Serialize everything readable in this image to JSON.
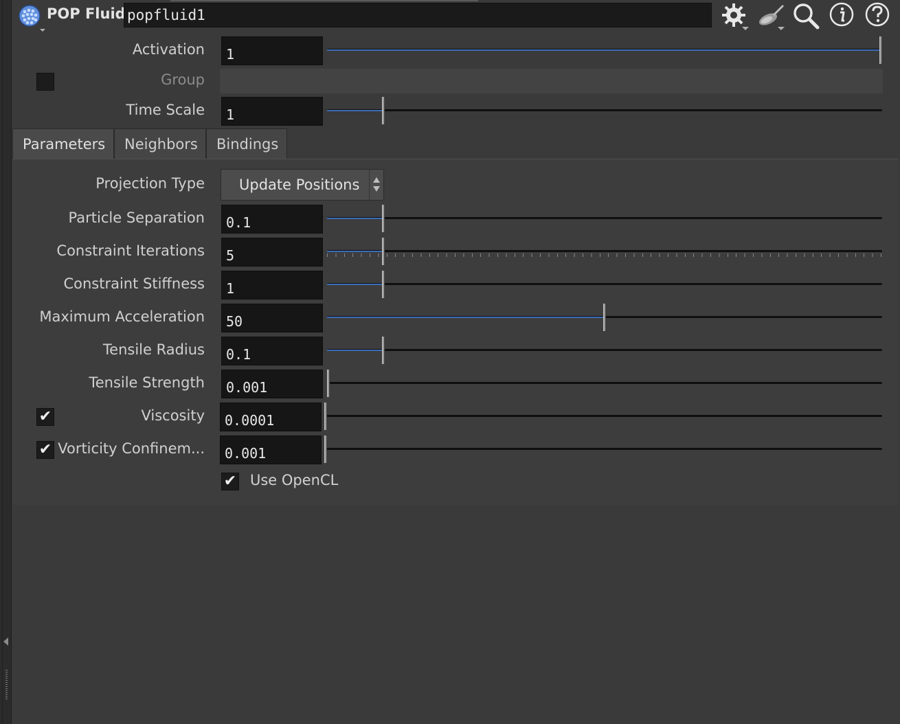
{
  "header": {
    "node_type": "POP Fluid",
    "node_name": "popfluid1",
    "icons": [
      "node-type-icon",
      "gear-icon",
      "paint-brush-icon",
      "search-icon",
      "info-icon",
      "help-icon"
    ]
  },
  "top_params": {
    "activation": {
      "label": "Activation",
      "value": "1",
      "slider_fraction": 1.0
    },
    "group": {
      "label": "Group",
      "checked": false
    },
    "time_scale": {
      "label": "Time Scale",
      "value": "1",
      "slider_fraction": 0.1
    }
  },
  "tabs": [
    {
      "label": "Parameters",
      "active": true
    },
    {
      "label": "Neighbors",
      "active": false
    },
    {
      "label": "Bindings",
      "active": false
    }
  ],
  "parameters": {
    "projection_type": {
      "label": "Projection Type",
      "value": "Update Positions"
    },
    "particle_separation": {
      "label": "Particle Separation",
      "value": "0.1",
      "slider_fraction": 0.1
    },
    "constraint_iterations": {
      "label": "Constraint Iterations",
      "value": "5",
      "slider_fraction": 0.1
    },
    "constraint_stiffness": {
      "label": "Constraint Stiffness",
      "value": "1",
      "slider_fraction": 0.1
    },
    "maximum_acceleration": {
      "label": "Maximum Acceleration",
      "value": "50",
      "slider_fraction": 0.5
    },
    "tensile_radius": {
      "label": "Tensile Radius",
      "value": "0.1",
      "slider_fraction": 0.1
    },
    "tensile_strength": {
      "label": "Tensile Strength",
      "value": "0.001",
      "slider_fraction": 0.0
    },
    "viscosity": {
      "label": "Viscosity",
      "value": "0.0001",
      "slider_fraction": 0.0,
      "checked": true
    },
    "vorticity_confinement": {
      "label": "Vorticity Confinem...",
      "value": "0.001",
      "slider_fraction": 0.0,
      "checked": true
    },
    "use_opencl": {
      "label": "Use OpenCL",
      "checked": true
    }
  },
  "colors": {
    "background": "#3a3a3a",
    "field": "#161616",
    "slider_fill": "#3b6db8"
  },
  "check_glyph": "✔"
}
